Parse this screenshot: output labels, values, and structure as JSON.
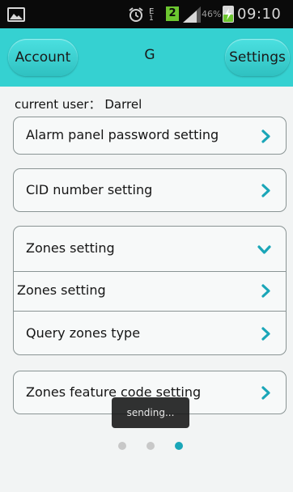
{
  "status_bar": {
    "sim1_label": "E",
    "sim1_number": "1",
    "sim2_badge": "2",
    "battery_percent": "46%",
    "battery_level": 0.46,
    "time": "09:10",
    "accent_color": "#6cc630"
  },
  "header": {
    "account_label": "Account",
    "title": "G",
    "settings_label": "Settings",
    "color": "#35d1d1"
  },
  "current_user": "current user：  Darrel",
  "settings_list": {
    "alarm_panel_password": "Alarm panel password setting",
    "cid_number": "CID number setting",
    "zones_group": {
      "header": "Zones setting",
      "expanded": true,
      "items": [
        "Zones setting",
        "Query zones type"
      ]
    },
    "zones_feature_code": "Zones feature code setting"
  },
  "toast": "sending...",
  "pager": {
    "pages": 3,
    "current": 3,
    "active_color": "#1aa6b8",
    "inactive_color": "#c8c8c8"
  }
}
